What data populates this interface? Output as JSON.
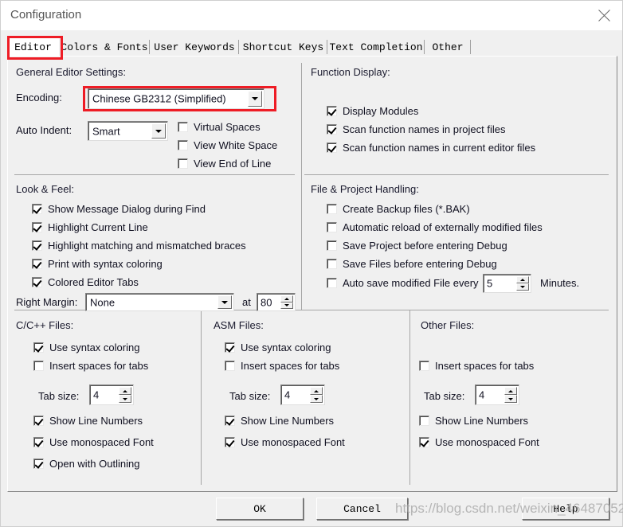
{
  "window": {
    "title": "Configuration",
    "close_icon": "close-icon"
  },
  "tabs": [
    {
      "label": "Editor",
      "active": true
    },
    {
      "label": "Colors & Fonts",
      "active": false
    },
    {
      "label": "User Keywords",
      "active": false
    },
    {
      "label": "Shortcut Keys",
      "active": false
    },
    {
      "label": "Text Completion",
      "active": false
    },
    {
      "label": "Other",
      "active": false
    }
  ],
  "general_editor": {
    "title": "General Editor Settings:",
    "encoding_label": "Encoding:",
    "encoding_value": "Chinese GB2312 (Simplified)",
    "auto_indent_label": "Auto Indent:",
    "auto_indent_value": "Smart",
    "checks": [
      {
        "label": "Virtual Spaces",
        "checked": false
      },
      {
        "label": "View White Space",
        "checked": false
      },
      {
        "label": "View End of Line",
        "checked": false
      }
    ]
  },
  "function_display": {
    "title": "Function Display:",
    "checks": [
      {
        "label": "Display Modules",
        "checked": true
      },
      {
        "label": "Scan function names in project files",
        "checked": true
      },
      {
        "label": "Scan function names in current editor files",
        "checked": true
      }
    ]
  },
  "look_feel": {
    "title": "Look & Feel:",
    "checks": [
      {
        "label": "Show Message Dialog during Find",
        "checked": true
      },
      {
        "label": "Highlight Current Line",
        "checked": true
      },
      {
        "label": "Highlight matching and mismatched braces",
        "checked": true
      },
      {
        "label": "Print with syntax coloring",
        "checked": true
      },
      {
        "label": "Colored Editor Tabs",
        "checked": true
      }
    ],
    "right_margin_label": "Right Margin:",
    "right_margin_value": "None",
    "at_label": "at",
    "at_value": "80"
  },
  "file_project": {
    "title": "File & Project Handling:",
    "checks": [
      {
        "label": "Create Backup files (*.BAK)",
        "checked": false
      },
      {
        "label": "Automatic reload of externally modified files",
        "checked": false
      },
      {
        "label": "Save Project before entering Debug",
        "checked": false
      },
      {
        "label": "Save Files before entering Debug",
        "checked": false
      },
      {
        "label": "Auto save modified File every",
        "checked": false
      }
    ],
    "autosave_value": "5",
    "minutes_label": "Minutes."
  },
  "file_columns": [
    {
      "title": "C/C++ Files:",
      "tab_size_label": "Tab size:",
      "tab_size_value": "4",
      "checks_top": [
        {
          "label": "Use syntax coloring",
          "checked": true
        },
        {
          "label": "Insert spaces for tabs",
          "checked": false
        }
      ],
      "checks_bottom": [
        {
          "label": "Show Line Numbers",
          "checked": true
        },
        {
          "label": "Use monospaced Font",
          "checked": true
        },
        {
          "label": "Open with Outlining",
          "checked": true
        }
      ]
    },
    {
      "title": "ASM Files:",
      "tab_size_label": "Tab size:",
      "tab_size_value": "4",
      "checks_top": [
        {
          "label": "Use syntax coloring",
          "checked": true
        },
        {
          "label": "Insert spaces for tabs",
          "checked": false
        }
      ],
      "checks_bottom": [
        {
          "label": "Show Line Numbers",
          "checked": true
        },
        {
          "label": "Use monospaced Font",
          "checked": true
        }
      ]
    },
    {
      "title": "Other Files:",
      "tab_size_label": "Tab size:",
      "tab_size_value": "4",
      "checks_top": [
        {
          "label": "Insert spaces for tabs",
          "checked": false
        }
      ],
      "checks_bottom": [
        {
          "label": "Show Line Numbers",
          "checked": false
        },
        {
          "label": "Use monospaced Font",
          "checked": true
        }
      ]
    }
  ],
  "buttons": {
    "ok": "OK",
    "cancel": "Cancel",
    "help": "Help"
  },
  "annotations": {
    "highlight_color": "#ee1c25"
  },
  "watermark": {
    "text": "https://blog.csdn.net/weixin_46487052"
  }
}
